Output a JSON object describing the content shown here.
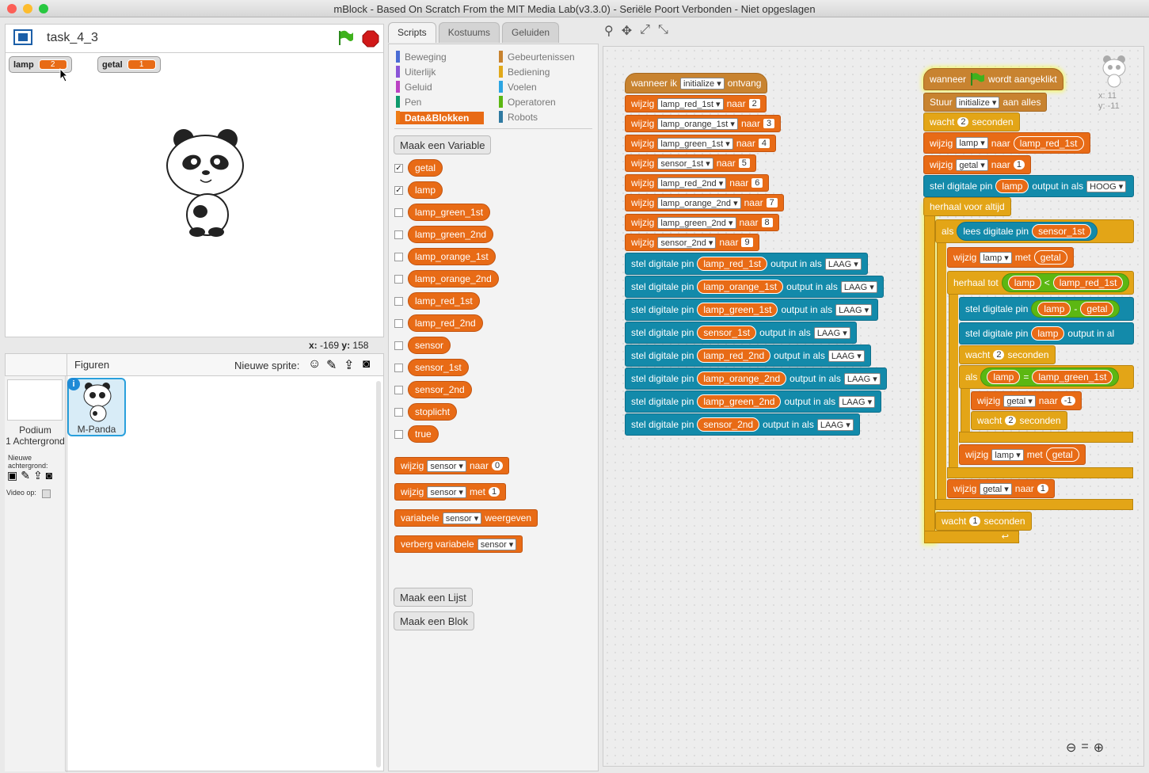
{
  "window": {
    "title": "mBlock - Based On Scratch From the MIT Media Lab(v3.3.0) - Seriële Poort Verbonden - Niet opgeslagen"
  },
  "stage": {
    "project_name": "task_4_3",
    "monitors": [
      {
        "label": "lamp",
        "value": "2"
      },
      {
        "label": "getal",
        "value": "1"
      }
    ],
    "coords_x_label": "x:",
    "coords_x": "-169",
    "coords_y_label": "y:",
    "coords_y": "158"
  },
  "sprites": {
    "title": "Figuren",
    "new_sprite": "Nieuwe sprite:",
    "podium": "Podium",
    "podium_sub": "1 Achtergrond",
    "new_backdrop": "Nieuwe achtergrond:",
    "video": "Video op:",
    "sprite_name": "M-Panda"
  },
  "tabs": [
    "Scripts",
    "Kostuums",
    "Geluiden"
  ],
  "categories": [
    {
      "label": "Beweging",
      "color": "#4a6cd4"
    },
    {
      "label": "Gebeurtenissen",
      "color": "#c88330"
    },
    {
      "label": "Uiterlijk",
      "color": "#8a55d7"
    },
    {
      "label": "Bediening",
      "color": "#e1a91a"
    },
    {
      "label": "Geluid",
      "color": "#bb42c3"
    },
    {
      "label": "Voelen",
      "color": "#2ca5e2"
    },
    {
      "label": "Pen",
      "color": "#0e9a6c"
    },
    {
      "label": "Operatoren",
      "color": "#5cb712"
    },
    {
      "label": "Data&Blokken",
      "color": "#ee7d16"
    },
    {
      "label": "Robots",
      "color": "#2f7aa2"
    }
  ],
  "palette": {
    "make_variable": "Maak een Variable",
    "variables": [
      {
        "name": "getal",
        "checked": true
      },
      {
        "name": "lamp",
        "checked": true
      },
      {
        "name": "lamp_green_1st",
        "checked": false
      },
      {
        "name": "lamp_green_2nd",
        "checked": false
      },
      {
        "name": "lamp_orange_1st",
        "checked": false
      },
      {
        "name": "lamp_orange_2nd",
        "checked": false
      },
      {
        "name": "lamp_red_1st",
        "checked": false
      },
      {
        "name": "lamp_red_2nd",
        "checked": false
      },
      {
        "name": "sensor",
        "checked": false
      },
      {
        "name": "sensor_1st",
        "checked": false
      },
      {
        "name": "sensor_2nd",
        "checked": false
      },
      {
        "name": "stoplicht",
        "checked": false
      },
      {
        "name": "true",
        "checked": false
      }
    ],
    "set_block": [
      "wijzig",
      "sensor",
      "naar",
      "0"
    ],
    "change_block": [
      "wijzig",
      "sensor",
      "met",
      "1"
    ],
    "show_block": [
      "variabele",
      "sensor",
      "weergeven"
    ],
    "hide_block": [
      "verberg variabele",
      "sensor"
    ],
    "make_list": "Maak een Lijst",
    "make_block": "Maak een Blok"
  },
  "scripts": {
    "script1": {
      "hat": [
        "wanneer ik",
        "initialize",
        "ontvang"
      ],
      "sets": [
        [
          "lamp_red_1st",
          "2"
        ],
        [
          "lamp_orange_1st",
          "3"
        ],
        [
          "lamp_green_1st",
          "4"
        ],
        [
          "sensor_1st",
          "5"
        ],
        [
          "lamp_red_2nd",
          "6"
        ],
        [
          "lamp_orange_2nd",
          "7"
        ],
        [
          "lamp_green_2nd",
          "8"
        ],
        [
          "sensor_2nd",
          "9"
        ]
      ],
      "set_word": "wijzig",
      "to_word": "naar",
      "pins": [
        "lamp_red_1st",
        "lamp_orange_1st",
        "lamp_green_1st",
        "sensor_1st",
        "lamp_red_2nd",
        "lamp_orange_2nd",
        "lamp_green_2nd",
        "sensor_2nd"
      ],
      "pin_prefix": "stel digitale pin",
      "pin_mid": "output in als",
      "pin_val": "LAAG"
    },
    "script2": {
      "hat": [
        "wanneer",
        "wordt aangeklikt"
      ],
      "broadcast": [
        "Stuur",
        "initialize",
        "aan alles"
      ],
      "wait": [
        "wacht",
        "2",
        "seconden"
      ],
      "set_lamp": [
        "wijzig",
        "lamp",
        "naar",
        "lamp_red_1st"
      ],
      "set_getal": [
        "wijzig",
        "getal",
        "naar",
        "1"
      ],
      "pin1": [
        "stel digitale pin",
        "lamp",
        "output in als",
        "HOOG"
      ],
      "forever": "herhaal voor altijd",
      "if1": [
        "als",
        "lees digitale pin",
        "sensor_1st"
      ],
      "change_lamp": [
        "wijzig",
        "lamp",
        "met",
        "getal"
      ],
      "until": [
        "herhaal tot",
        "lamp",
        "<",
        "lamp_red_1st"
      ],
      "pin2": [
        "stel digitale pin",
        "lamp",
        "-",
        "getal"
      ],
      "pin3": [
        "stel digitale pin",
        "lamp",
        "output in al"
      ],
      "wait2": [
        "wacht",
        "2",
        "seconden"
      ],
      "if2": [
        "als",
        "lamp",
        "=",
        "lamp_green_1st"
      ],
      "set_getal2": [
        "wijzig",
        "getal",
        "naar",
        "-1"
      ],
      "wait3": [
        "wacht",
        "2",
        "seconden"
      ],
      "change_lamp2": [
        "wijzig",
        "lamp",
        "met",
        "getal"
      ],
      "set_getal3": [
        "wijzig",
        "getal",
        "naar",
        "1"
      ],
      "wait4": [
        "wacht",
        "1",
        "seconden"
      ]
    },
    "sprite_x": "x: 11",
    "sprite_y": "y: -11"
  }
}
